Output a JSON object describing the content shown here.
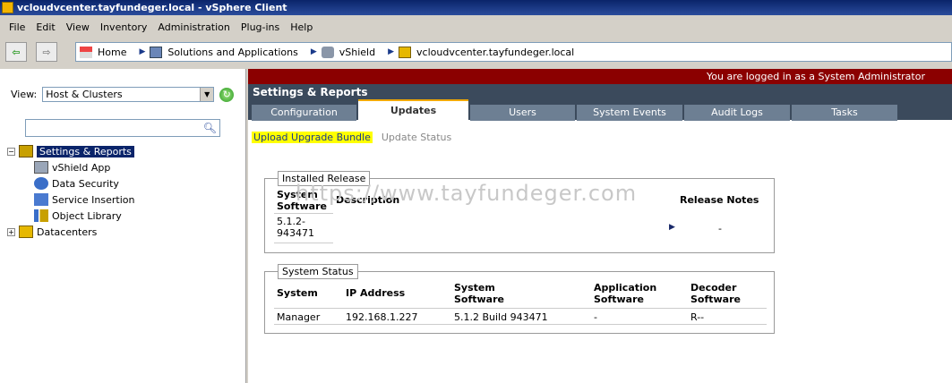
{
  "window": {
    "title": "vcloudvcenter.tayfundeger.local - vSphere Client"
  },
  "menu": [
    "File",
    "Edit",
    "View",
    "Inventory",
    "Administration",
    "Plug-ins",
    "Help"
  ],
  "breadcrumb": [
    "Home",
    "Solutions and Applications",
    "vShield",
    "vcloudvcenter.tayfundeger.local"
  ],
  "left": {
    "view_label": "View:",
    "view_value": "Host & Clusters",
    "tree": {
      "root": "Settings & Reports",
      "children": [
        "vShield App",
        "Data Security",
        "Service Insertion",
        "Object Library"
      ],
      "datacenters": "Datacenters"
    }
  },
  "right": {
    "login_status": "You are logged in as a System Administrator",
    "section_title": "Settings & Reports",
    "tabs": [
      "Configuration",
      "Updates",
      "Users",
      "System Events",
      "Audit Logs",
      "Tasks"
    ],
    "subtabs": {
      "upload": "Upload Upgrade Bundle",
      "status": "Update Status"
    },
    "installed": {
      "legend": "Installed Release",
      "headers": [
        "System Software",
        "Description",
        "Release Notes"
      ],
      "row": {
        "software": "5.1.2- 943471",
        "description": "",
        "notes": "-"
      }
    },
    "status": {
      "legend": "System Status",
      "headers": [
        "System",
        "IP Address",
        "System Software",
        "Application Software",
        "Decoder Software"
      ],
      "row": [
        "Manager",
        "192.168.1.227",
        "5.1.2 Build 943471",
        "-",
        "R--"
      ]
    }
  },
  "watermark": "https://www.tayfundeger.com",
  "colors": {
    "accent_red": "#8b0000",
    "header_slate": "#3b4a5c",
    "highlight": "#ffff00"
  }
}
